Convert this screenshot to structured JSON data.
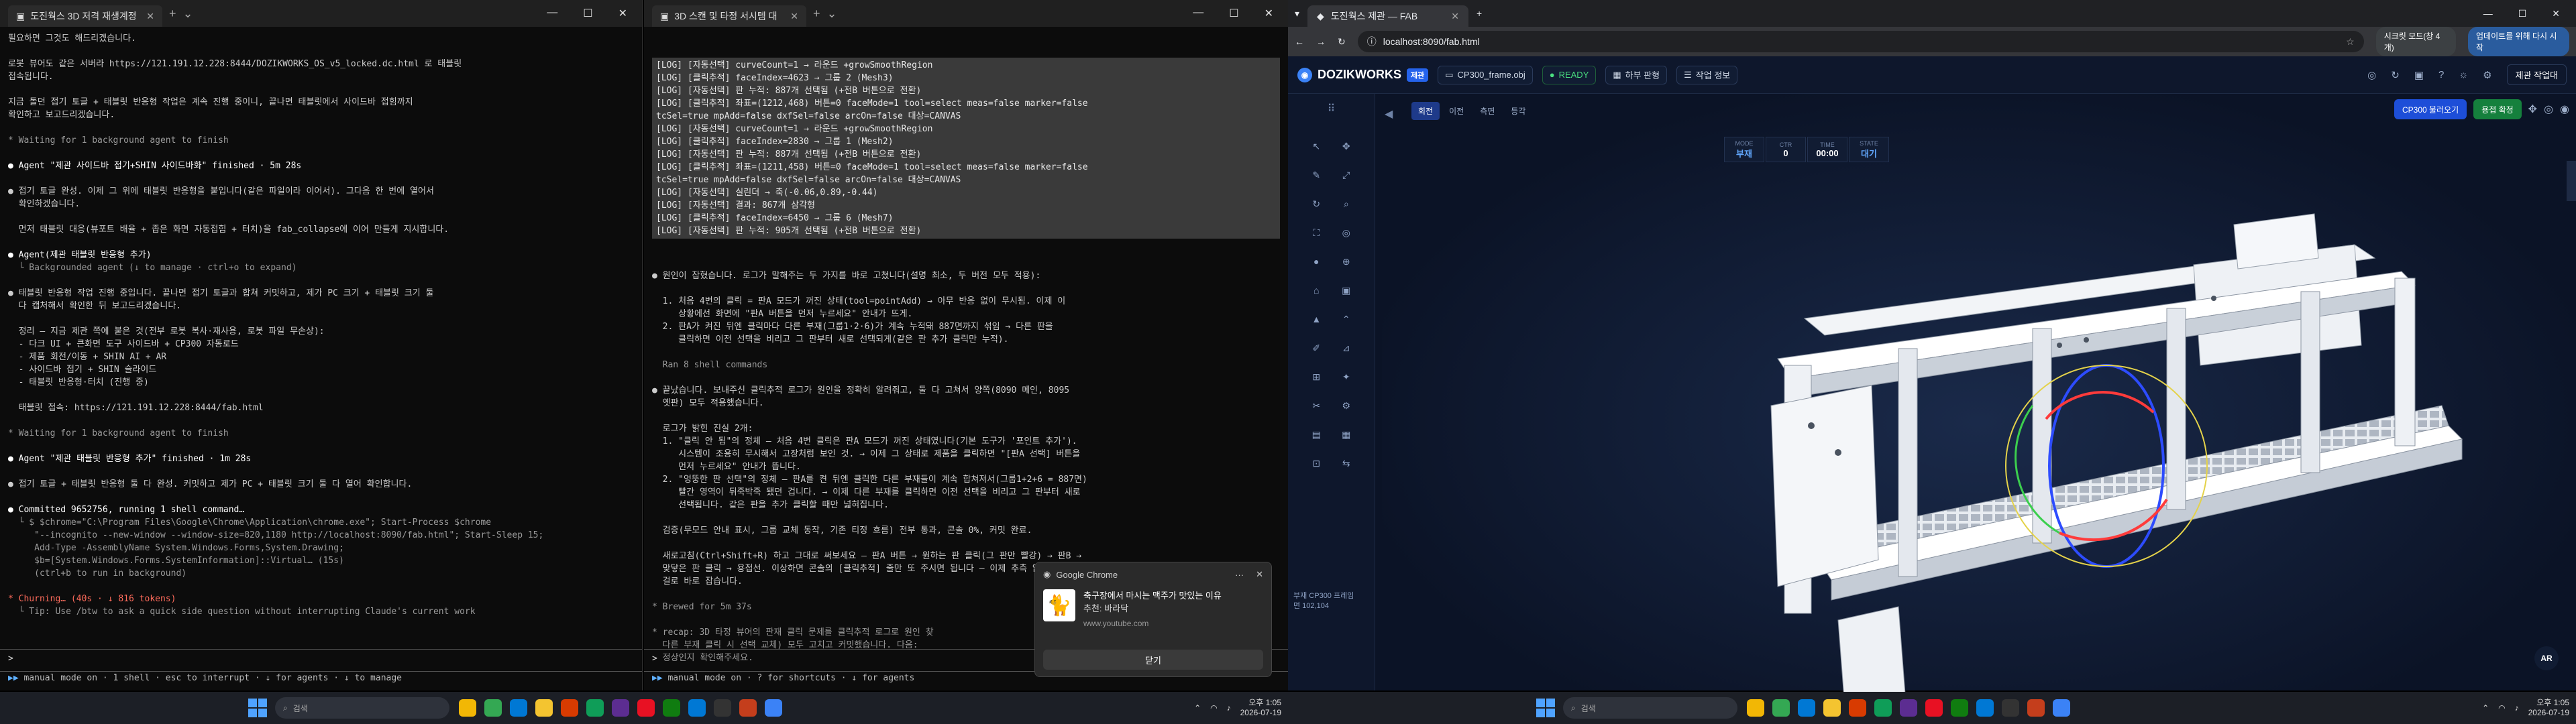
{
  "left_terminal": {
    "tab_title": "도진웍스 3D 저격 재생계정",
    "lines": [
      {
        "t": "필요하면 그것도 해드리겠습니다.",
        "c": ""
      },
      {
        "t": "",
        "c": ""
      },
      {
        "t": "로봇 뷰어도 같은 서버라 https://121.191.12.228:8444/DOZIKWORKS_OS_v5_locked.dc.html 로 태블릿",
        "c": ""
      },
      {
        "t": "접속됩니다.",
        "c": ""
      },
      {
        "t": "",
        "c": ""
      },
      {
        "t": "지금 돌던 접기 토글 + 태블릿 반응형 작업은 계속 진행 중이니, 끝나면 태블릿에서 사이드바 접힘까지",
        "c": ""
      },
      {
        "t": "확인하고 보고드리겠습니다.",
        "c": ""
      },
      {
        "t": "",
        "c": ""
      },
      {
        "t": "* Waiting for 1 background agent to finish",
        "c": "c-dim"
      },
      {
        "t": "",
        "c": ""
      },
      {
        "t": "● Agent \"제관 사이드바 접기+SHIN 사이드바화\" finished · 5m 28s",
        "c": "c-white"
      },
      {
        "t": "",
        "c": ""
      },
      {
        "t": "● 접기 토글 완성. 이제 그 위에 태블릿 반응형을 붙입니다(같은 파일이라 이어서). 그다음 한 번에 열어서",
        "c": ""
      },
      {
        "t": "  확인하겠습니다.",
        "c": ""
      },
      {
        "t": "",
        "c": ""
      },
      {
        "t": "  먼저 태블릿 대응(뷰포트 배율 + 좁은 화면 자동접힘 + 터치)을 fab_collapse에 이어 만들게 지시합니다.",
        "c": ""
      },
      {
        "t": "",
        "c": ""
      },
      {
        "t": "● Agent(제관 태블릿 반응형 추가)",
        "c": "c-white"
      },
      {
        "t": "  └ Backgrounded agent (↓ to manage · ctrl+o to expand)",
        "c": "c-dim"
      },
      {
        "t": "",
        "c": ""
      },
      {
        "t": "● 태블릿 반응형 작업 진행 중입니다. 끝나면 접기 토글과 합쳐 커밋하고, 제가 PC 크기 + 태블릿 크기 둘",
        "c": ""
      },
      {
        "t": "  다 캡처해서 확인한 뒤 보고드리겠습니다.",
        "c": ""
      },
      {
        "t": "",
        "c": ""
      },
      {
        "t": "  정리 — 지금 제관 쪽에 붙은 것(전부 로봇 복사·재사용, 로봇 파일 무손상):",
        "c": ""
      },
      {
        "t": "  - 다크 UI + 큰화면 도구 사이드바 + CP300 자동로드",
        "c": ""
      },
      {
        "t": "  - 제품 회전/이동 + SHIN AI + AR",
        "c": ""
      },
      {
        "t": "  - 사이드바 접기 + SHIN 슬라이드",
        "c": ""
      },
      {
        "t": "  - 태블릿 반응형·터치 (진행 중)",
        "c": ""
      },
      {
        "t": "",
        "c": ""
      },
      {
        "t": "  태블릿 접속: https://121.191.12.228:8444/fab.html",
        "c": ""
      },
      {
        "t": "",
        "c": ""
      },
      {
        "t": "* Waiting for 1 background agent to finish",
        "c": "c-dim"
      },
      {
        "t": "",
        "c": ""
      },
      {
        "t": "● Agent \"제관 태블릿 반응형 추가\" finished · 1m 28s",
        "c": "c-white"
      },
      {
        "t": "",
        "c": ""
      },
      {
        "t": "● 접기 토글 + 태블릿 반응형 둘 다 완성. 커밋하고 제가 PC + 태블릿 크기 둘 다 열어 확인합니다.",
        "c": ""
      },
      {
        "t": "",
        "c": ""
      },
      {
        "t": "● Committed 9652756, running 1 shell command…",
        "c": "c-white"
      },
      {
        "t": "  └ $ $chrome=\"C:\\Program Files\\Google\\Chrome\\Application\\chrome.exe\"; Start-Process $chrome",
        "c": "c-dim"
      },
      {
        "t": "     \"--incognito --new-window --window-size=820,1180 http://localhost:8090/fab.html\"; Start-Sleep 15;",
        "c": "c-dim"
      },
      {
        "t": "     Add-Type -AssemblyName System.Windows.Forms,System.Drawing;",
        "c": "c-dim"
      },
      {
        "t": "     $b=[System.Windows.Forms.SystemInformation]::Virtual… (15s)",
        "c": "c-dim"
      },
      {
        "t": "     (ctrl+b to run in background)",
        "c": "c-dim"
      },
      {
        "t": "",
        "c": ""
      },
      {
        "t": "* Churning… (40s · ↓ 816 tokens)",
        "c": "c-red"
      },
      {
        "t": "  └ Tip: Use /btw to ask a quick side question without interrupting Claude's current work",
        "c": "c-dim"
      }
    ],
    "prompt": ">",
    "status": "manual mode on · 1 shell · esc to interrupt · ↓ for agents · ↓ to manage"
  },
  "right_terminal": {
    "tab_title": "3D 스캔 및 타정 서시템 대",
    "log_lines": [
      "[LOG] [자동선택] curveCount=1 → 라운드 +growSmoothRegion",
      "[LOG] [클릭추적] faceIndex=4623 → 그룹 2 (Mesh3)",
      "[LOG] [자동선택] 판 누적: 887개 선택됨 (+전B 버튼으로 전환)",
      "[LOG] [클릭추적] 좌표=(1212,468) 버튼=0 faceMode=1 tool=select meas=false marker=false",
      "tcSel=true mpAdd=false dxfSel=false arcOn=false 대상=CANVAS",
      "[LOG] [자동선택] curveCount=1 → 라운드 +growSmoothRegion",
      "[LOG] [클릭추적] faceIndex=2830 → 그룹 1 (Mesh2)",
      "[LOG] [자동선택] 판 누적: 887개 선택됨 (+전B 버튼으로 전환)",
      "[LOG] [클릭추적] 좌표=(1211,458) 버튼=0 faceMode=1 tool=select meas=false marker=false",
      "tcSel=true mpAdd=false dxfSel=false arcOn=false 대상=CANVAS",
      "[LOG] [자동선택] 실린더 → 축(-0.06,0.89,-0.44)",
      "[LOG] [자동선택] 결과: 867개 삼각형",
      "[LOG] [클릭추적] faceIndex=6450 → 그룹 6 (Mesh7)",
      "[LOG] [자동선택] 판 누적: 905개 선택됨 (+전B 버튼으로 전환)"
    ],
    "lines": [
      {
        "t": "● 원인이 잡혔습니다. 로그가 말해주는 두 가지를 바로 고쳤니다(설명 최소, 두 버전 모두 적용):",
        "c": ""
      },
      {
        "t": "",
        "c": ""
      },
      {
        "t": "  1. 처음 4번의 클릭 = 판A 모드가 꺼진 상태(tool=pointAdd) → 아무 반응 없이 무시됨. 이제 이",
        "c": ""
      },
      {
        "t": "     상황에선 화면에 \"판A 버튼을 먼저 누르세요\" 안내가 뜨게.",
        "c": ""
      },
      {
        "t": "  2. 판A가 켜진 뒤엔 클릭마다 다른 부재(그룹1·2·6)가 계속 누적돼 887면까지 섞임 → 다른 판을",
        "c": ""
      },
      {
        "t": "     클릭하면 이전 선택을 비리고 그 판부터 새로 선택되게(같은 판 추가 클릭만 누적).",
        "c": ""
      },
      {
        "t": "",
        "c": ""
      },
      {
        "t": "  Ran 8 shell commands",
        "c": "c-dim"
      },
      {
        "t": "",
        "c": ""
      },
      {
        "t": "● 끝났습니다. 보내주신 클릭추적 로그가 원인을 정확히 알려줘고, 둘 다 고쳐서 양쪽(8090 메인, 8095",
        "c": ""
      },
      {
        "t": "  옛판) 모두 적용했습니다.",
        "c": ""
      },
      {
        "t": "",
        "c": ""
      },
      {
        "t": "  로그가 밝힌 진실 2개:",
        "c": ""
      },
      {
        "t": "  1. \"클릭 안 됨\"의 정체 — 처음 4번 클릭은 판A 모드가 꺼진 상태였니다(기본 도구가 '포인트 추가').",
        "c": ""
      },
      {
        "t": "     시스템이 조용히 무시해서 고장처럼 보인 것. → 이제 그 상태로 제품을 클릭하면 \"[판A 선택] 버튼을",
        "c": ""
      },
      {
        "t": "     먼저 누르세요\" 안내가 뜹니다.",
        "c": ""
      },
      {
        "t": "  2. \"엉뚱한 판 선택\"의 정체 — 판A를 켠 뒤엔 클릭한 다른 부재들이 계속 합쳐져서(그룹1+2+6 = 887면)",
        "c": ""
      },
      {
        "t": "     빨간 영역이 뒤죽박죽 됐던 겁니다. → 이제 다른 부재를 클릭하면 이전 선택을 비리고 그 판부터 새로",
        "c": ""
      },
      {
        "t": "     선택됩니다. 같은 판을 추가 클릭할 때만 넓혀집니다.",
        "c": ""
      },
      {
        "t": "",
        "c": ""
      },
      {
        "t": "  검증(무모드 안내 표시, 그룹 교체 동작, 기존 티정 흐름) 전부 통과, 콘솔 0%, 커밋 완료.",
        "c": ""
      },
      {
        "t": "",
        "c": ""
      },
      {
        "t": "  새로고침(Ctrl+Shift+R) 하고 그대로 써보세요 — 판A 버튼 → 원하는 판 클릭(그 판만 빨강) → 판B →",
        "c": ""
      },
      {
        "t": "  맞닿은 판 클릭 → 용접선. 이상하면 콘솔의 [클릭추적] 줄만 또 주시면 됩니다 — 이제 추측 없이 그",
        "c": ""
      },
      {
        "t": "  걸로 바로 잡습니다.",
        "c": ""
      },
      {
        "t": "",
        "c": ""
      },
      {
        "t": "* Brewed for 5m 37s",
        "c": "c-dim"
      },
      {
        "t": "",
        "c": ""
      },
      {
        "t": "* recap: 3D 타정 뷰어의 판재 클릭 문제를 클릭추적 로그로 원인 찾",
        "c": "c-dim"
      },
      {
        "t": "  다른 부재 클릭 시 선택 교체) 모두 고치고 커밋했습니다. 다음:",
        "c": "c-dim"
      },
      {
        "t": "  정상인지 확인해주세요.",
        "c": "c-dim"
      }
    ],
    "prompt": ">",
    "status": "manual mode on · ? for shortcuts · ↓ for agents",
    "new_hint": "new"
  },
  "notification": {
    "app": "Google Chrome",
    "title": "축구장에서 마시는 맥주가 맛있는 이유",
    "body": "추천: 바라닥",
    "site": "www.youtube.com",
    "button": "닫기",
    "thumb_glyph": "🐈"
  },
  "taskbar_left": {
    "search": "검색",
    "clock_time": "오후 1:05",
    "clock_date": "2026-07-19"
  },
  "taskbar_right": {
    "search": "검색",
    "clock_time": "오후 1:05",
    "clock_date": "2026-07-19"
  },
  "browser": {
    "tab_title": "도진웍스 제관 — FAB",
    "url": "localhost:8090/fab.html",
    "chip1": "시크릿 모드(창 4개)",
    "chip2": "업데이트를 위해 다시 시작"
  },
  "app": {
    "logo": "DOZIKWORKS",
    "logo_badge": "제관",
    "file": "CP300_frame.obj",
    "ready": "READY",
    "btn_parts": "하부 판형",
    "btn_info": "작업 정보",
    "exit": "제관 작업대",
    "vp_tabs": [
      {
        "label": "회전",
        "active": true
      },
      {
        "label": "이전",
        "active": false
      },
      {
        "label": "측면",
        "active": false
      },
      {
        "label": "등각",
        "active": false
      }
    ],
    "btn_load": "CP300 불러오기",
    "btn_ok": "용접 확정",
    "stats": [
      {
        "k": "MODE",
        "v": "부재",
        "blue": true
      },
      {
        "k": "CTR",
        "v": "0",
        "blue": false
      },
      {
        "k": "TIME",
        "v": "00:00",
        "blue": false
      },
      {
        "k": "STATE",
        "v": "대기",
        "blue": true
      }
    ],
    "side_info": "부재 CP300 프레임\n면 102,104",
    "ar": "AR",
    "sidebar_icons": [
      "↖",
      "✥",
      "✎",
      "⤢",
      "↻",
      "⌕",
      "⛶",
      "◎",
      "●",
      "⊕",
      "⌂",
      "▣",
      "▲",
      "⌃",
      "✐",
      "⊿",
      "⊞",
      "✦",
      "✂",
      "⚙",
      "▤",
      "▦",
      "⊡",
      "⇆"
    ]
  },
  "colors": {
    "accent": "#2563eb",
    "ready": "#4ade80",
    "term_bg": "#0c0c0c",
    "app_bg": "#0b1326"
  }
}
